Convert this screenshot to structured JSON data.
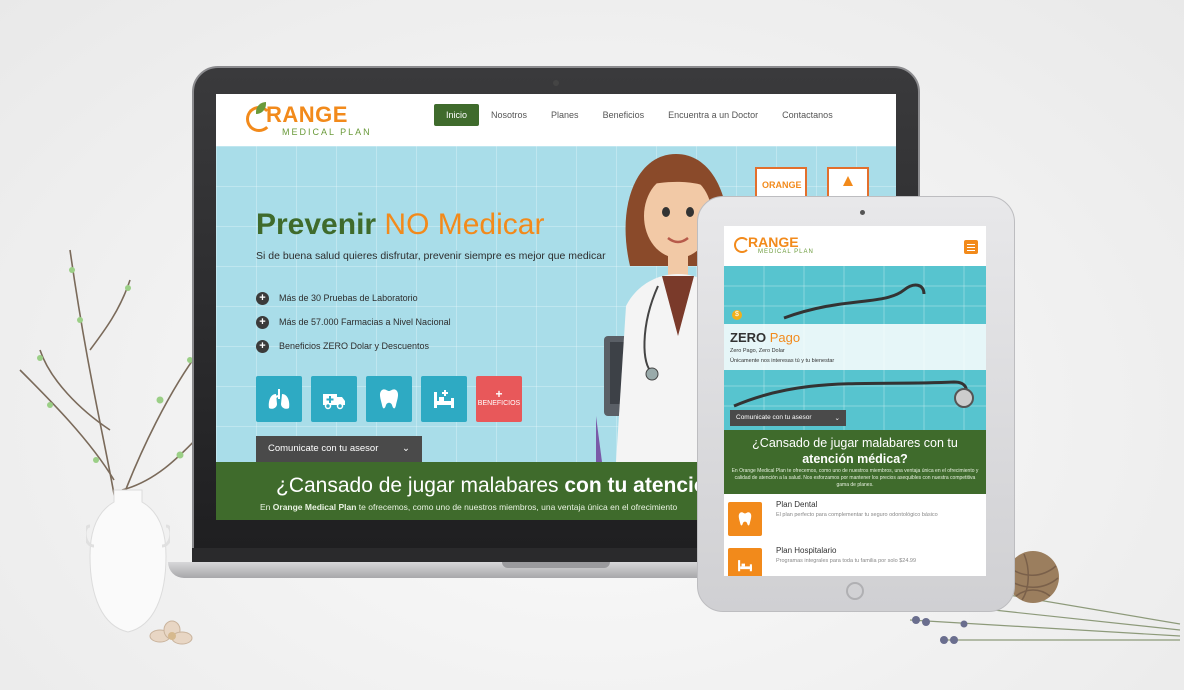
{
  "laptop_site": {
    "logo": {
      "word": "RANGE",
      "sub": "MEDICAL PLAN"
    },
    "nav": [
      {
        "label": "Inicio",
        "active": true
      },
      {
        "label": "Nosotros",
        "active": false
      },
      {
        "label": "Planes",
        "active": false
      },
      {
        "label": "Beneficios",
        "active": false
      },
      {
        "label": "Encuentra a un Doctor",
        "active": false
      },
      {
        "label": "Contactanos",
        "active": false
      }
    ],
    "hero": {
      "title_a": "Prevenir",
      "title_b": "NO Medicar",
      "subtitle": "Si de buena salud quieres disfrutar, prevenir siempre es mejor que medicar",
      "bullets": [
        "Más de 30 Pruebas de Laboratorio",
        "Más de 57.000 Farmacias a Nivel Nacional",
        "Beneficios ZERO Dolar y Descuentos"
      ],
      "tiles": [
        "lungs-icon",
        "ambulance-icon",
        "tooth-icon",
        "hospital-bed-icon"
      ],
      "benefits_plus": "+",
      "benefits_label": "BENEFICIOS",
      "advisor_label": "Comunicate con tu asesor",
      "advisor_caret": "⌄"
    },
    "band": {
      "heading_a": "¿Cansado de jugar malabares",
      "heading_b": "con tu atencio",
      "text_prefix": "En",
      "text_brand": "Orange Medical Plan",
      "text_rest": "te ofrecemos, como uno de nuestros miembros, una ventaja única en el ofrecimiento"
    }
  },
  "tablet_site": {
    "logo": {
      "word": "RANGE",
      "sub": "MEDICAL PLAN"
    },
    "hero": {
      "coin": "$",
      "title_a": "ZERO",
      "title_b": "Pago",
      "line1": "Zero Pago, Zero Dolar",
      "line2": "Únicamente nos interesas tú y tu bienestar",
      "advisor_label": "Comunicate con tu asesor",
      "advisor_caret": "⌄"
    },
    "band": {
      "heading_a": "¿Cansado de jugar malabares con tu",
      "heading_b": "atención médica?",
      "text": "En Orange Medical Plan te ofrecemos, como uno de nuestros miembros, una ventaja única en el ofrecimiento y calidad de atención a la salud. Nos esforzamos por mantener los precios asequibles con nuestra competitiva gama de planes."
    },
    "plans": [
      {
        "name": "Plan Dental",
        "desc": "El plan perfecto para complementar tu seguro odontológico básico",
        "icon": "tooth-icon"
      },
      {
        "name": "Plan Hospitalario",
        "desc": "Programas integrales para toda tu familia por solo $24.99",
        "icon": "hospital-bed-icon"
      }
    ]
  },
  "colors": {
    "brand_orange": "#f28a1b",
    "brand_green": "#3f6b2c",
    "hero_blue": "#a9dde9",
    "tile_blue": "#2eaac3",
    "benefits_red": "#e8585a"
  }
}
